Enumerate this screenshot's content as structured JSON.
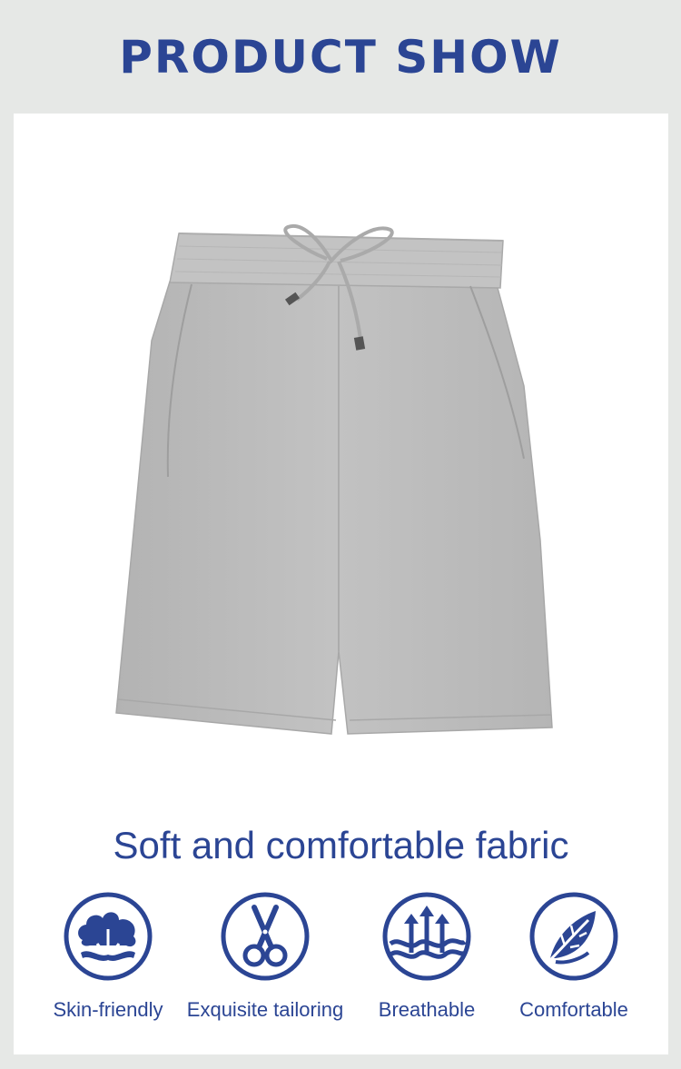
{
  "header": {
    "title": "PRODUCT SHOW"
  },
  "product": {
    "image_alt": "grey drawstring shorts",
    "color": "#bcbcbc"
  },
  "tagline": "Soft and comfortable fabric",
  "features": [
    {
      "label": "Skin-friendly",
      "icon": "cotton-icon"
    },
    {
      "label": "Exquisite tailoring",
      "icon": "scissors-icon"
    },
    {
      "label": "Breathable",
      "icon": "breathable-arrows-icon"
    },
    {
      "label": "Comfortable",
      "icon": "leaf-icon"
    }
  ],
  "colors": {
    "accent": "#2b4594",
    "background": "#e6e8e6",
    "card": "#ffffff"
  }
}
